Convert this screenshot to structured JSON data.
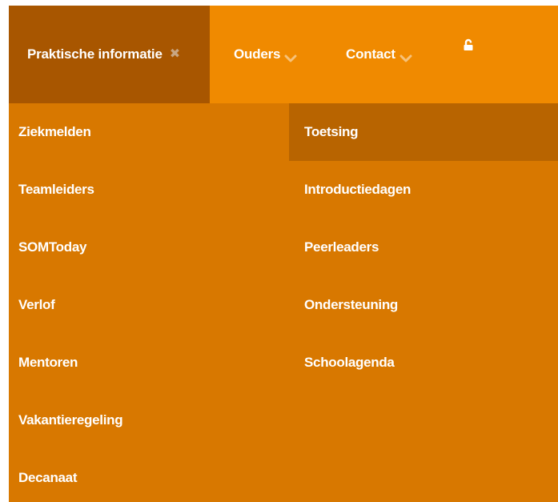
{
  "nav": {
    "active_label": "Praktische informatie",
    "ouders_label": "Ouders",
    "contact_label": "Contact",
    "close_glyph": "✖"
  },
  "colors": {
    "topbar": "#f08a00",
    "active_tab": "#a85600",
    "dropdown": "#d87800",
    "dropdown_active_item": "#b86400",
    "text": "#ffffff"
  },
  "icons": {
    "close": "close-icon",
    "chevron": "chevron-down-icon",
    "lock": "unlocked-padlock-icon"
  },
  "dropdown": {
    "left": [
      {
        "label": "Ziekmelden"
      },
      {
        "label": "Teamleiders"
      },
      {
        "label": "SOMToday"
      },
      {
        "label": "Verlof"
      },
      {
        "label": "Mentoren"
      },
      {
        "label": "Vakantieregeling"
      },
      {
        "label": "Decanaat"
      }
    ],
    "right": [
      {
        "label": "Toetsing",
        "active": true
      },
      {
        "label": "Introductiedagen"
      },
      {
        "label": "Peerleaders"
      },
      {
        "label": "Ondersteuning"
      },
      {
        "label": "Schoolagenda"
      }
    ]
  }
}
